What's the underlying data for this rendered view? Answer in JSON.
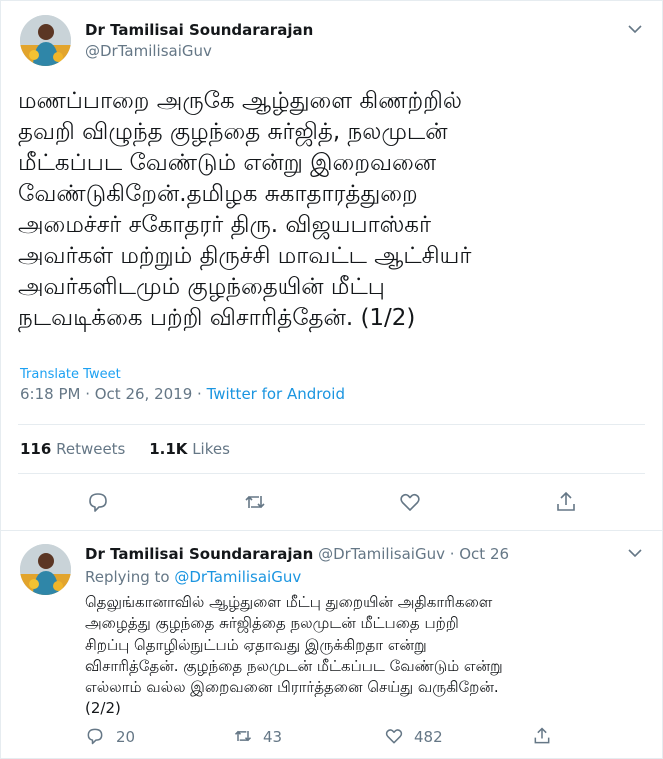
{
  "tweet": {
    "author_name": "Dr Tamilisai Soundararajan",
    "author_handle": "@DrTamilisaiGuv",
    "text_lines": [
      "மணப்பாறை அருகே ஆழ்துளை கிணற்றில்",
      "தவறி விழுந்த குழந்தை சுர்ஜித், நலமுடன்",
      "மீட்கப்பட வேண்டும் என்று இறைவனை",
      "வேண்டுகிறேன்.தமிழக சுகாதாரத்துறை",
      "அமைச்சர் சகோதரர் திரு. விஜயபாஸ்கர்",
      "அவர்கள் மற்றும் திருச்சி மாவட்ட ஆட்சியர்",
      "அவர்களிடமும் குழந்தையின் மீட்பு",
      "நடவடிக்கை பற்றி விசாரித்தேன். (1/2)"
    ],
    "translate_label": "Translate Tweet",
    "timestamp": "6:18 PM · Oct 26, 2019 · ",
    "source": "Twitter for Android",
    "retweets_count": "116",
    "retweets_label": "Retweets",
    "likes_count": "1.1K",
    "likes_label": "Likes"
  },
  "reply": {
    "author_name": "Dr Tamilisai Soundararajan",
    "author_handle_date": "@DrTamilisaiGuv · Oct 26",
    "replying_prefix": "Replying to ",
    "replying_handle": "@DrTamilisaiGuv",
    "text_lines": [
      "தெலுங்கானாவில் ஆழ்துளை மீட்பு துறையின் அதிகாரிகளை",
      "அழைத்து குழந்தை சுர்ஜித்தை நலமுடன் மீட்பதை பற்றி",
      "சிறப்பு தொழில்நுட்பம் ஏதாவது  இருக்கிறதா என்று",
      "விசாரித்தேன். குழந்தை நலமுடன் மீட்கப்பட வேண்டும் என்று",
      "எல்லாம் வல்ல இறைவனை பிரார்த்தனை செய்து வருகிறேன்.",
      "(2/2)"
    ],
    "reply_count": "20",
    "retweet_count": "43",
    "like_count": "482"
  },
  "icons": {
    "reply": "speech-bubble-icon",
    "retweet": "retweet-arrows-icon",
    "like": "heart-icon",
    "share": "share-upload-icon",
    "more": "chevron-down-icon"
  },
  "colors": {
    "link": "#1b95e0",
    "translate": "#1da1f2",
    "secondary_text": "#657786",
    "divider": "#e6ecf0"
  }
}
